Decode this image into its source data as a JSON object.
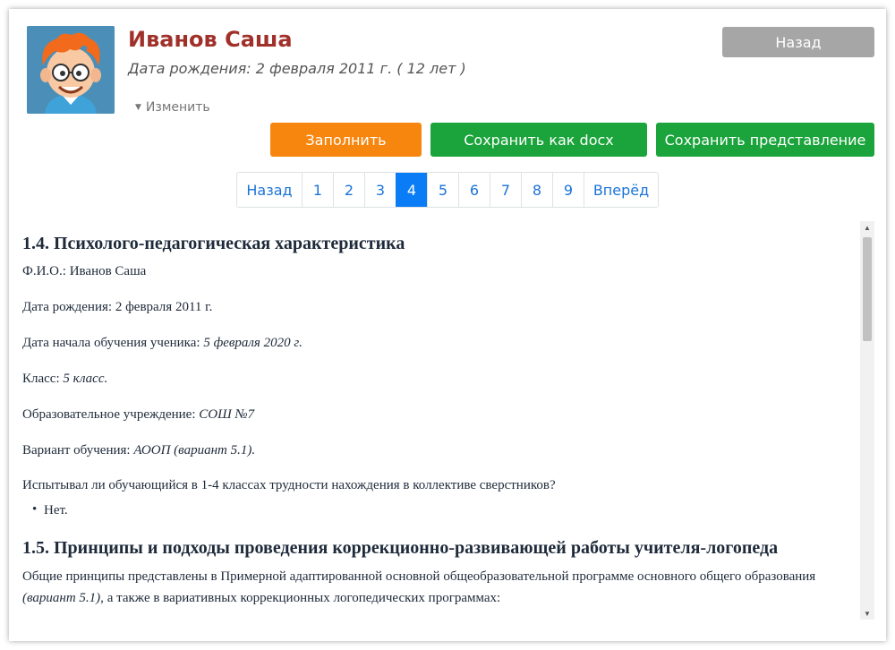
{
  "header": {
    "name": "Иванов Саша",
    "birth": "Дата рождения: 2 февраля 2011 г. ( 12 лет )",
    "edit_label": "Изменить",
    "back_label": "Назад"
  },
  "actions": {
    "fill_label": "Заполнить",
    "docx_label": "Сохранить как docx",
    "save_label": "Сохранить представление"
  },
  "pager": {
    "prev": "Назад",
    "pages": [
      "1",
      "2",
      "3",
      "4",
      "5",
      "6",
      "7",
      "8",
      "9"
    ],
    "active": "4",
    "next": "Вперёд"
  },
  "doc": {
    "h1": "1.4. Психолого-педагогическая характеристика",
    "fio_label": "Ф.И.О.: ",
    "fio_value": "Иванов Саша",
    "birth_label": "Дата рождения: ",
    "birth_value": "2 февраля 2011 г.",
    "start_label": "Дата начала обучения ученика: ",
    "start_value": "5 февраля 2020 г.",
    "class_label": "Класс: ",
    "class_value": "5 класс.",
    "school_label": "Образовательное учреждение: ",
    "school_value": "СОШ №7",
    "variant_label": "Вариант обучения: ",
    "variant_value": "АООП (вариант 5.1).",
    "question": "Испытывал ли обучающийся в 1-4 классах трудности нахождения в коллективе сверстников?",
    "answer": "Нет.",
    "h2": "1.5. Принципы и подходы проведения коррекционно-развивающей работы учителя-логопеда",
    "para1": "Общие принципы представлены в Примерной адаптированной основной общеобразовательной программе основного общего образования",
    "para2_italic": "(вариант 5.1),",
    "para2_rest": " а также в вариативных коррекционных логопедических программах:"
  },
  "colors": {
    "name": "#a0312a",
    "orange": "#f7860e",
    "green": "#1aa43b",
    "gray": "#a6a6a6",
    "active_page": "#0a7cf5"
  }
}
